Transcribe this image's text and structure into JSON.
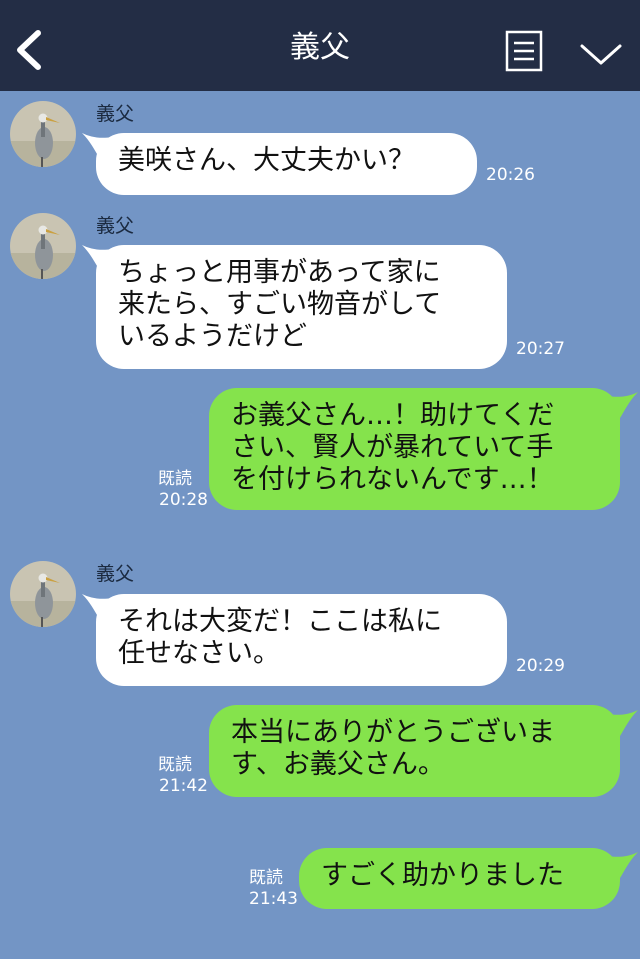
{
  "header": {
    "title": "義父"
  },
  "messages": [
    {
      "side": "in",
      "sender": "義父",
      "text": "美咲さん、大丈夫かい？",
      "time": "20:26"
    },
    {
      "side": "in",
      "sender": "義父",
      "text": "ちょっと用事があって家に\n来たら、すごい物音がして\nいるようだけど",
      "time": "20:27"
    },
    {
      "side": "out",
      "read": "既読",
      "text": "お義父さん…！助けてくだ\nさい、賢人が暴れていて手\nを付けられないんです…！",
      "time": "20:28"
    },
    {
      "side": "in",
      "sender": "義父",
      "text": "それは大変だ！ここは私に\n任せなさい。",
      "time": "20:29"
    },
    {
      "side": "out",
      "read": "既読",
      "text": "本当にありがとうございま\nす、お義父さん。",
      "time": "21:42"
    },
    {
      "side": "out",
      "read": "既読",
      "text": "すごく助かりました",
      "time": "21:43"
    }
  ],
  "colors": {
    "header_bg": "#232d45",
    "chat_bg": "#7395c5",
    "incoming_bubble": "#ffffff",
    "outgoing_bubble": "#85e34c"
  },
  "icons": {
    "back": "chevron-left-icon",
    "menu": "document-menu-icon",
    "more": "chevron-down-icon",
    "avatar": "heron-avatar"
  }
}
